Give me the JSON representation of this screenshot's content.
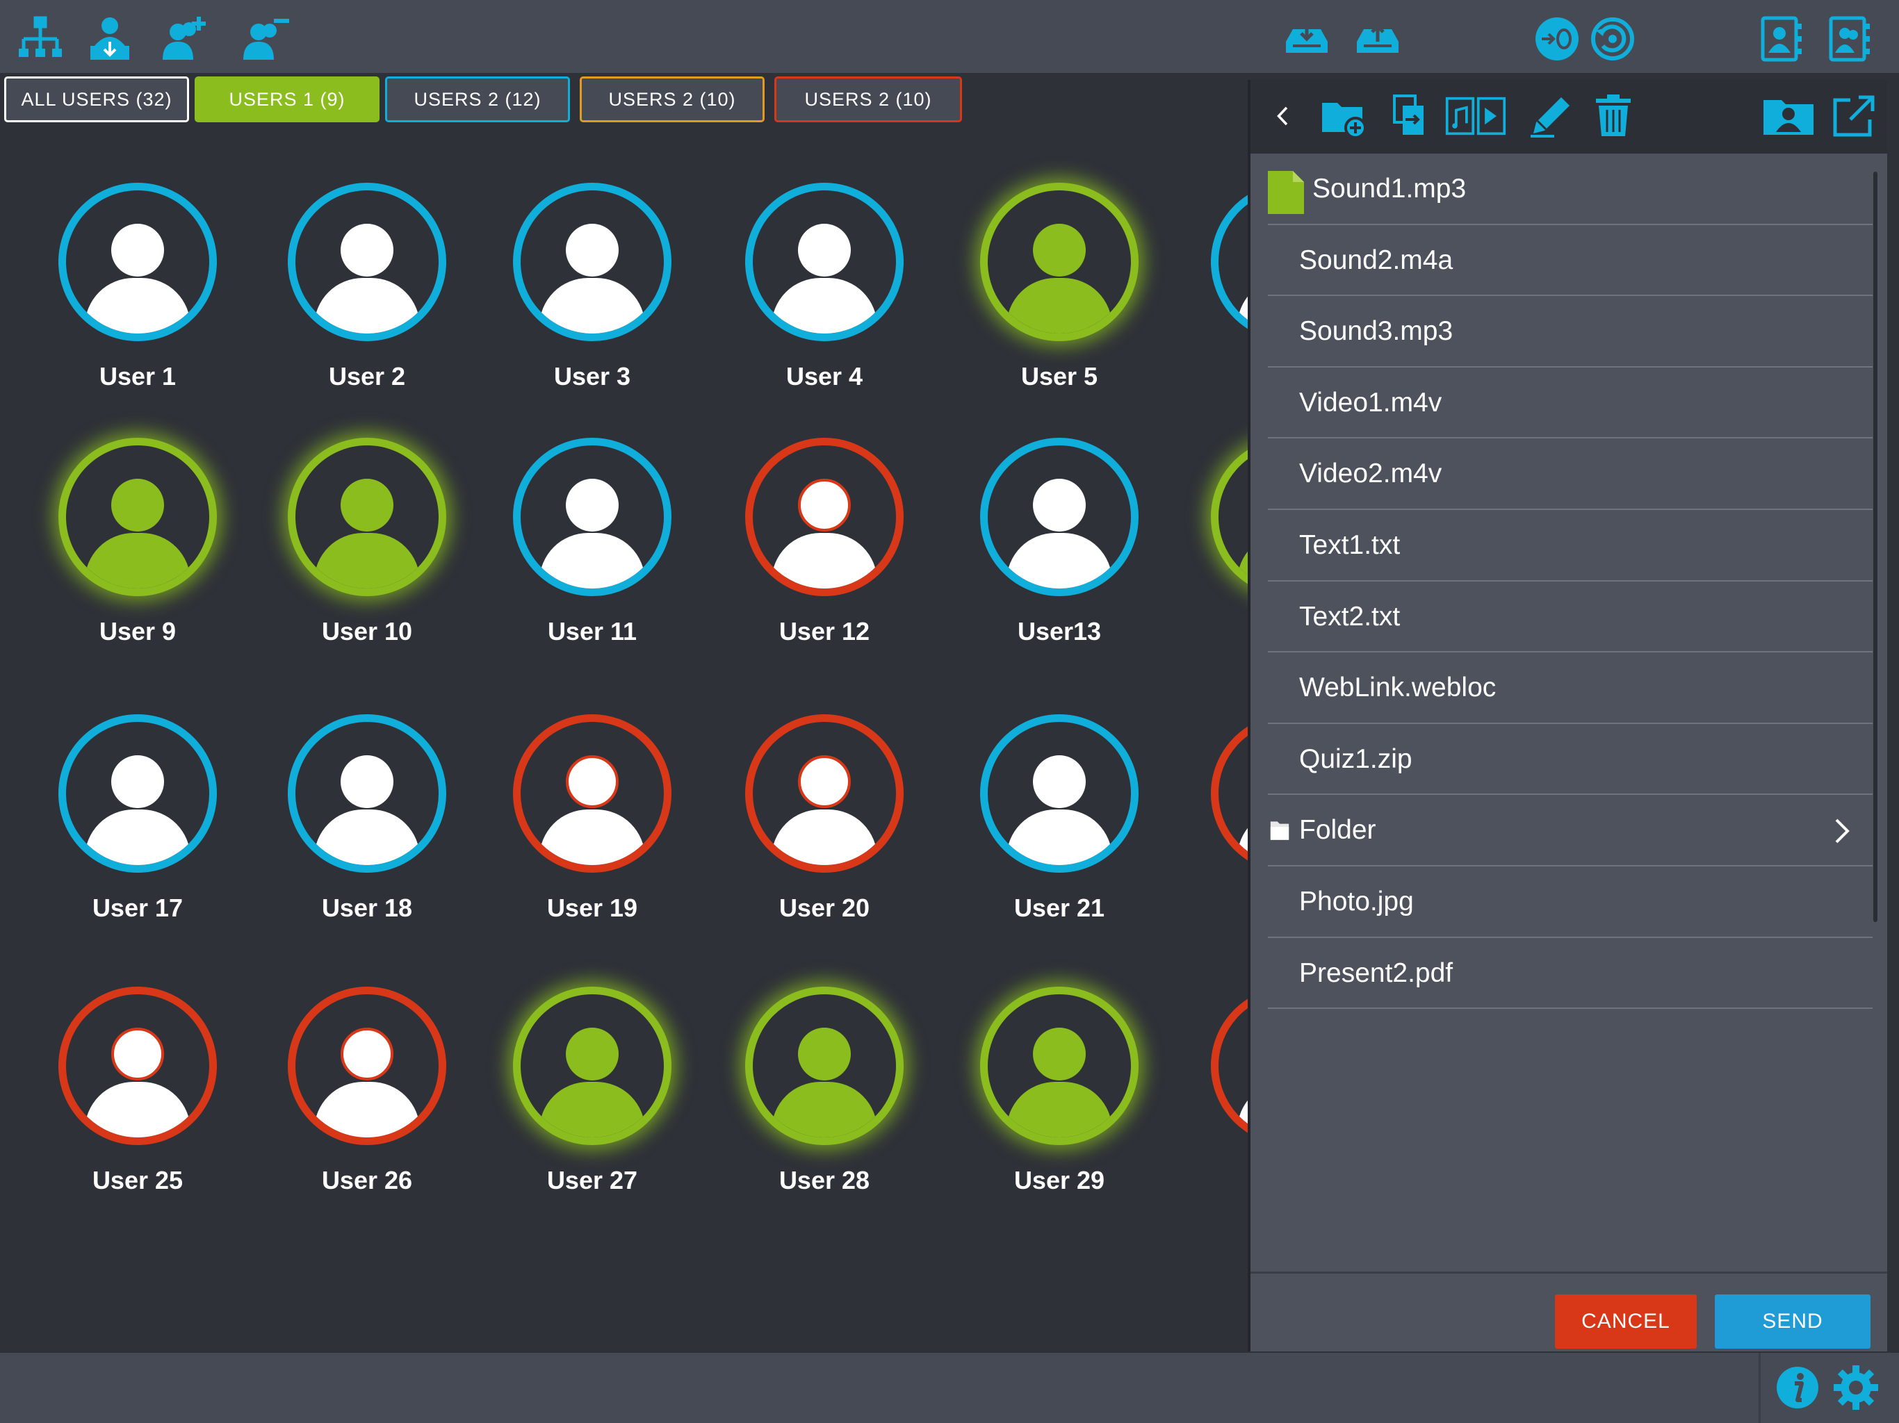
{
  "colors": {
    "accent_blue": "#10aedb",
    "status_green": "#8bbd1e",
    "status_red": "#d93818",
    "tab_white": "#ffffff",
    "tab_orange": "#e39b1f",
    "cancel": "#d93818",
    "send": "#1f9bd6"
  },
  "toolbar": {
    "left_icons": [
      "network-icon",
      "user-download-icon",
      "add-user-icon",
      "remove-user-icon"
    ],
    "middle_icons": [
      "cloud-download-icon",
      "cloud-upload-icon"
    ],
    "round_icons": [
      "reset-counter-icon",
      "undo-icon"
    ],
    "right_icons": [
      "contacts-book-icon",
      "contacts-book-group-icon"
    ]
  },
  "tabs": [
    {
      "label": "ALL USERS (32)",
      "color": "#ffffff",
      "active": false
    },
    {
      "label": "USERS 1 (9)",
      "color": "#8bbd1e",
      "active": true
    },
    {
      "label": "USERS 2 (12)",
      "color": "#10aedb",
      "active": false
    },
    {
      "label": "USERS 2 (10)",
      "color": "#e39b1f",
      "active": false
    },
    {
      "label": "USERS 2 (10)",
      "color": "#d93818",
      "active": false
    }
  ],
  "users": [
    {
      "name": "User 1",
      "status": "blue"
    },
    {
      "name": "User 2",
      "status": "blue"
    },
    {
      "name": "User 3",
      "status": "blue"
    },
    {
      "name": "User 4",
      "status": "blue"
    },
    {
      "name": "User 5",
      "status": "green"
    },
    {
      "name": "",
      "status": "blue"
    },
    {
      "name": "User 9",
      "status": "green"
    },
    {
      "name": "User 10",
      "status": "green"
    },
    {
      "name": "User 11",
      "status": "blue"
    },
    {
      "name": "User 12",
      "status": "red"
    },
    {
      "name": "User13",
      "status": "blue"
    },
    {
      "name": "",
      "status": "green"
    },
    {
      "name": "User 17",
      "status": "blue"
    },
    {
      "name": "User 18",
      "status": "blue"
    },
    {
      "name": "User 19",
      "status": "red"
    },
    {
      "name": "User 20",
      "status": "red"
    },
    {
      "name": "User 21",
      "status": "blue"
    },
    {
      "name": "",
      "status": "red"
    },
    {
      "name": "User 25",
      "status": "red"
    },
    {
      "name": "User 26",
      "status": "red"
    },
    {
      "name": "User 27",
      "status": "green"
    },
    {
      "name": "User 28",
      "status": "green"
    },
    {
      "name": "User 29",
      "status": "green"
    },
    {
      "name": "",
      "status": "red"
    }
  ],
  "panel": {
    "toolbar_icons": [
      "back-chevron-icon",
      "new-folder-icon",
      "copy-file-icon",
      "media-files-icon",
      "edit-pen-icon",
      "trash-icon",
      "user-folder-icon",
      "share-export-icon"
    ],
    "files": [
      {
        "name": "Sound1.mp3",
        "type": "file",
        "selected": true
      },
      {
        "name": "Sound2.m4a",
        "type": "file"
      },
      {
        "name": "Sound3.mp3",
        "type": "file"
      },
      {
        "name": "Video1.m4v",
        "type": "file"
      },
      {
        "name": "Video2.m4v",
        "type": "file"
      },
      {
        "name": "Text1.txt",
        "type": "file"
      },
      {
        "name": "Text2.txt",
        "type": "file"
      },
      {
        "name": "WebLink.webloc",
        "type": "file"
      },
      {
        "name": "Quiz1.zip",
        "type": "file"
      },
      {
        "name": "Folder",
        "type": "folder"
      },
      {
        "name": "Photo.jpg",
        "type": "file"
      },
      {
        "name": "Present2.pdf",
        "type": "file"
      }
    ],
    "cancel_label": "CANCEL",
    "send_label": "SEND"
  },
  "bottombar": {
    "icons": [
      "info-icon",
      "settings-gear-icon"
    ]
  }
}
